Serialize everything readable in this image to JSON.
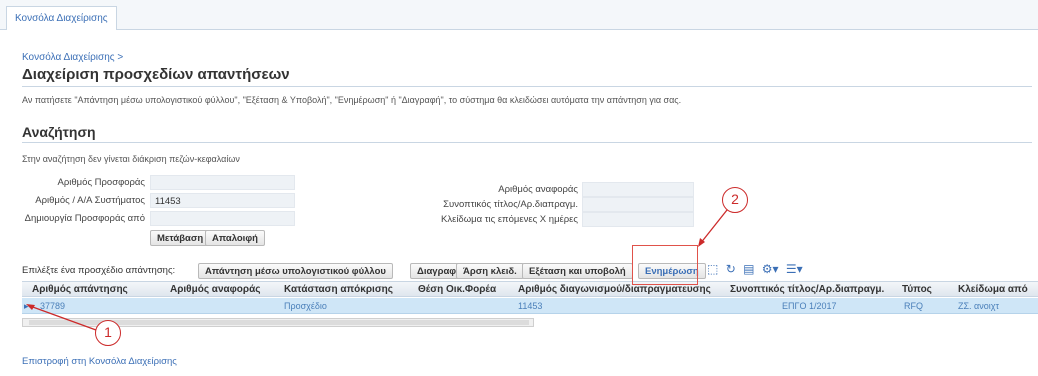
{
  "top_tab": "Κονσόλα Διαχείρισης",
  "breadcrumb": "Κονσόλα Διαχείρισης >",
  "page_title": "Διαχείριση προσχεδίων απαντήσεων",
  "instructions": "Αν πατήσετε \"Απάντηση μέσω υπολογιστικού φύλλου\", \"Εξέταση & Υποβολή\", \"Ενημέρωση\" ή \"Διαγραφή\", το σύστημα θα κλειδώσει αυτόματα την απάντηση για σας.",
  "search": {
    "section_title": "Αναζήτηση",
    "hint": "Στην αναζήτηση δεν γίνεται διάκριση πεζών-κεφαλαίων",
    "fields": [
      {
        "label": "Αριθμός Προσφοράς",
        "value": ""
      },
      {
        "label": "Αριθμός / Α/Α Συστήματος",
        "value": "11453"
      },
      {
        "label": "Δημιουργία Προσφοράς από",
        "value": ""
      },
      {
        "label": "Αριθμός αναφοράς",
        "value": ""
      },
      {
        "label": "Συνοπτικός τίτλος/Αρ.διαπραγμ.",
        "value": ""
      },
      {
        "label": "Κλείδωμα τις επόμενες Χ ημέρες",
        "value": ""
      }
    ],
    "go_button": "Μετάβαση",
    "clear_button": "Απαλοιφή"
  },
  "actions": {
    "select_label": "Επιλέξτε ένα προσχέδιο απάντησης:",
    "buttons": [
      "Απάντηση μέσω υπολογιστικού φύλλου",
      "Διαγραφή",
      "Άρση κλειδ.",
      "Εξέταση και υποβολή",
      "Ενημέρωση"
    ]
  },
  "table": {
    "columns": [
      "Αριθμός απάντησης",
      "Αριθμός αναφοράς",
      "Κατάσταση απόκρισης",
      "Θέση Οικ.Φορέα",
      "Αριθμός διαγωνισμού/διαπραγματευσης",
      "Συνοπτικός τίτλος/Αρ.διαπραγμ.",
      "Τύπος",
      "Κλείδωμα από"
    ],
    "rows": [
      [
        "37789",
        "",
        "Προσχέδιο",
        "",
        "11453",
        "ΕΠΓΟ 1/2017",
        "RFQ",
        "ΖΣ. ανοιχτ"
      ]
    ]
  },
  "back_link": "Επιστροφή στη Κονσόλα Διαχείρισης",
  "callouts": {
    "one": "1",
    "two": "2"
  },
  "colors": {
    "link": "#3b6fb6",
    "selected_row": "#cfe6f7",
    "callout": "#cc2a2a"
  },
  "icons": [
    "detach-icon",
    "refresh-icon",
    "export-icon",
    "settings-icon",
    "columns-icon"
  ]
}
